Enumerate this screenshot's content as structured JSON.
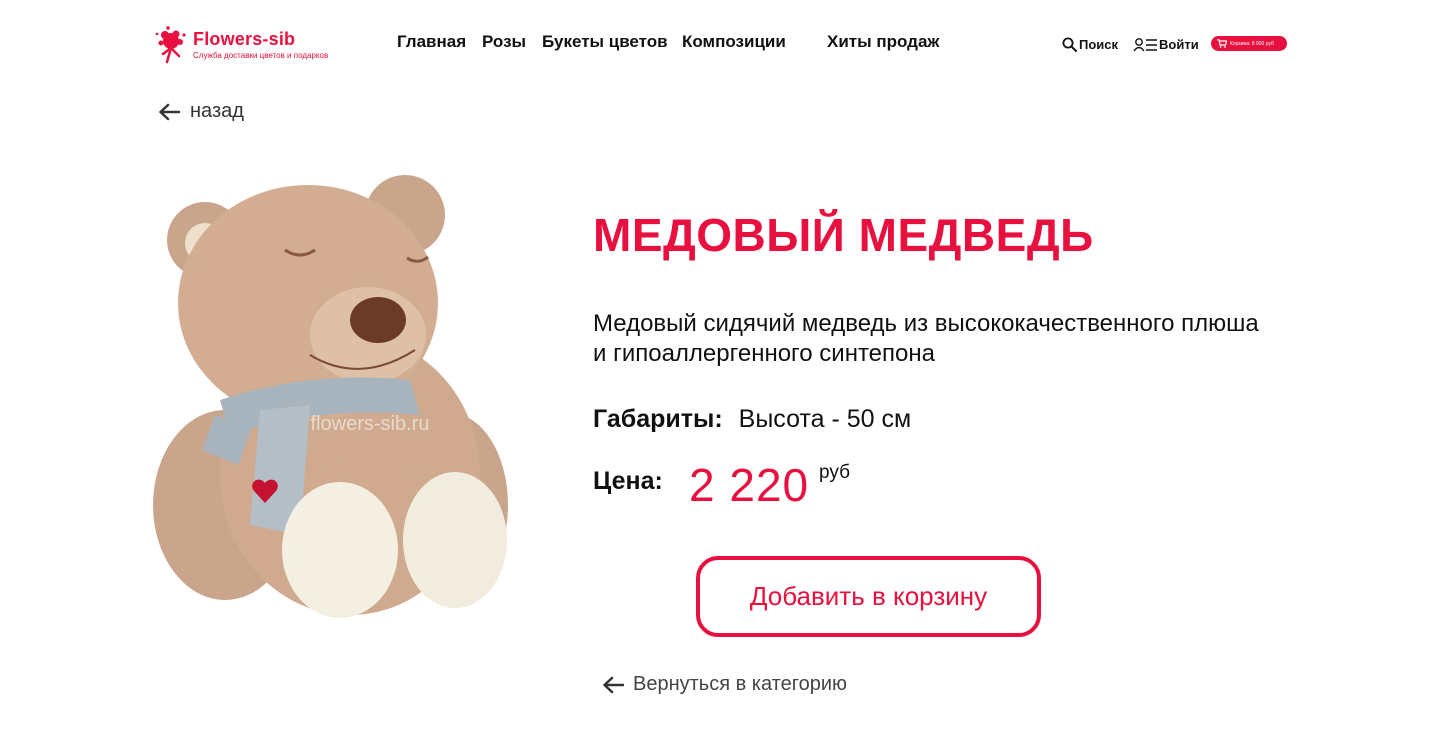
{
  "brand": {
    "name": "Flowers-sib",
    "tagline": "Служба доставки цветов и подарков",
    "accent": "#e8103f"
  },
  "nav": {
    "items": [
      "Главная",
      "Розы",
      "Букеты цветов",
      "Композиции",
      "Хиты продаж"
    ]
  },
  "utilities": {
    "search_label": "Поиск",
    "search_icon": "magnifier-icon",
    "login_label": "Войти",
    "login_icon": "user-menu-icon",
    "cart_label": "Корзина: 8 900 руб",
    "cart_icon": "cart-icon"
  },
  "back_link": {
    "label": "назад",
    "icon": "arrow-left-icon"
  },
  "product": {
    "title": "МЕДОВЫЙ МЕДВЕДЬ",
    "description": "Медовый сидячий медведь из высококачественного плюша и гипоаллергенного синтепона",
    "dimensions_label": "Габариты:",
    "dimensions_value": "Высота - 50 см",
    "price_label": "Цена:",
    "price_value": "2 220",
    "price_currency": "руб",
    "image_watermark": "flowers-sib.ru",
    "image_alt": "teddy-bear-with-scarf"
  },
  "add_to_cart_label": "Добавить в корзину",
  "back_to_category": {
    "label": "Вернуться в категорию",
    "icon": "arrow-left-icon"
  }
}
